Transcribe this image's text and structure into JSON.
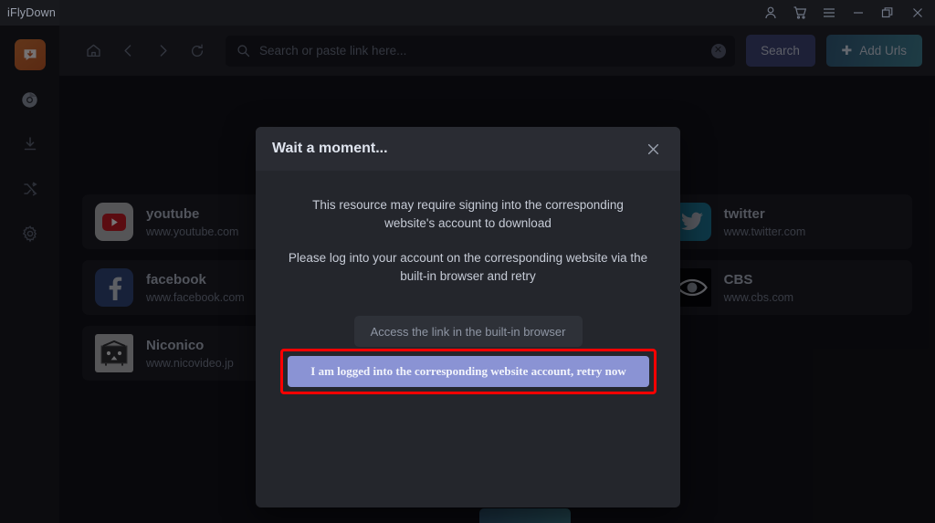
{
  "window": {
    "app_title": "iFlyDown",
    "controls": [
      {
        "name": "account-icon",
        "label": "Account"
      },
      {
        "name": "cart-icon",
        "label": "Cart"
      },
      {
        "name": "menu-icon",
        "label": "Menu"
      },
      {
        "name": "minimize-icon",
        "label": "Minimize"
      },
      {
        "name": "restore-icon",
        "label": "Restore"
      },
      {
        "name": "close-icon",
        "label": "Close"
      }
    ]
  },
  "sidebar": {
    "items": [
      {
        "name": "sidebar-item-downloader",
        "label": "Downloader",
        "active": true
      },
      {
        "name": "sidebar-item-browser",
        "label": "Browser",
        "active": false
      },
      {
        "name": "sidebar-item-downloads",
        "label": "Downloads",
        "active": false
      },
      {
        "name": "sidebar-item-converter",
        "label": "Converter",
        "active": false
      },
      {
        "name": "sidebar-item-settings",
        "label": "Settings",
        "active": false
      }
    ]
  },
  "toolbar": {
    "nav": [
      {
        "name": "home-icon",
        "label": "Home"
      },
      {
        "name": "back-icon",
        "label": "Back"
      },
      {
        "name": "forward-icon",
        "label": "Forward"
      },
      {
        "name": "refresh-icon",
        "label": "Refresh"
      }
    ],
    "search": {
      "placeholder": "Search or paste link here...",
      "value": "",
      "clear_label": "✕"
    },
    "search_button": "Search",
    "add_urls_button": "Add Urls",
    "add_urls_plus": "✚"
  },
  "sites": [
    {
      "name": "youtube",
      "url": "www.youtube.com",
      "logo": "youtube-logo",
      "color": "#b5b5b5"
    },
    {
      "name": "",
      "url": "",
      "logo": "hidden",
      "color": "#17181c"
    },
    {
      "name": "twitter",
      "url": "www.twitter.com",
      "logo": "twitter-logo",
      "color": "#17728f"
    },
    {
      "name": "facebook",
      "url": "www.facebook.com",
      "logo": "facebook-logo",
      "color": "#2d4373"
    },
    {
      "name": "",
      "url": "",
      "logo": "hidden",
      "color": "#17181c"
    },
    {
      "name": "CBS",
      "url": "www.cbs.com",
      "logo": "cbs-logo",
      "color": "#000000"
    },
    {
      "name": "Niconico",
      "url": "www.nicovideo.jp",
      "logo": "niconico-logo",
      "color": "#b9b9b9"
    }
  ],
  "dialog": {
    "title": "Wait a moment...",
    "close_label": "✕",
    "paragraph_1": "This resource may require signing into the corresponding website's account to download",
    "paragraph_2": "Please log into your account on the corresponding website via the built-in browser and retry",
    "builtin_browser_button": "Access the link in the built-in browser",
    "retry_button": "I am logged into the corresponding website account, retry now",
    "highlight_color": "#fe0000"
  }
}
